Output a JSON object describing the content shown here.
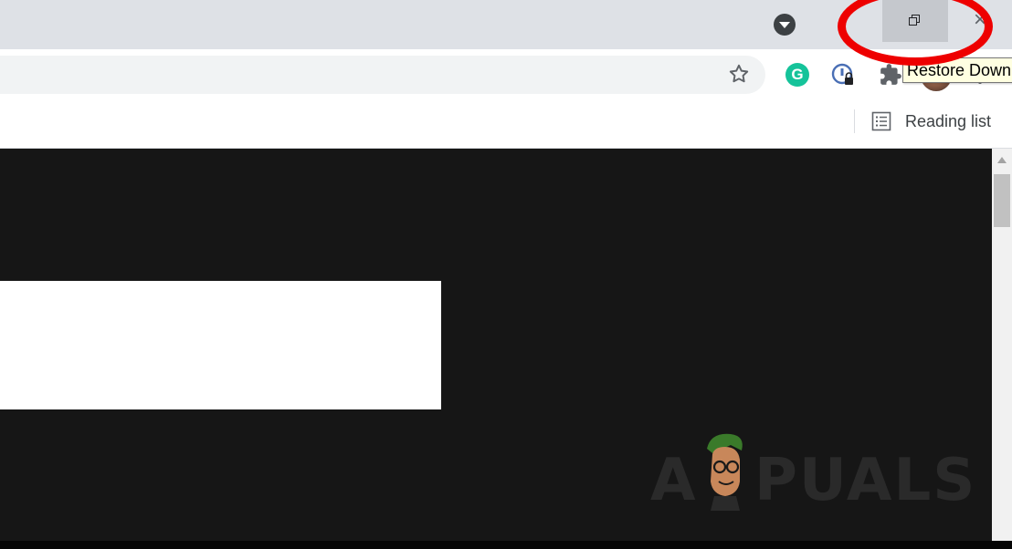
{
  "window": {
    "tab_search_icon": "tab-search-icon",
    "restore_icon": "restore-down-icon",
    "close_icon": "close-icon",
    "highlight_color": "#ee0000"
  },
  "toolbar": {
    "bookmark_icon": "star-icon",
    "extensions": [
      {
        "name": "grammarly",
        "glyph": "G",
        "color": "#15c39a"
      },
      {
        "name": "password-manager",
        "icon": "lock-badge-icon"
      },
      {
        "name": "extensions",
        "icon": "puzzle-icon"
      }
    ],
    "menu_icon": "more-vert-icon"
  },
  "tooltip": {
    "text": "Restore Down"
  },
  "bookmarks_bar": {
    "reading_list_label": "Reading list",
    "reading_list_icon": "reading-list-icon"
  },
  "watermark": {
    "brand": "APPUALS",
    "left_text": "A",
    "right_text": "PUALS"
  },
  "colors": {
    "titlebar": "#dee1e6",
    "content_bg": "#161616",
    "accent_green": "#15c39a"
  }
}
